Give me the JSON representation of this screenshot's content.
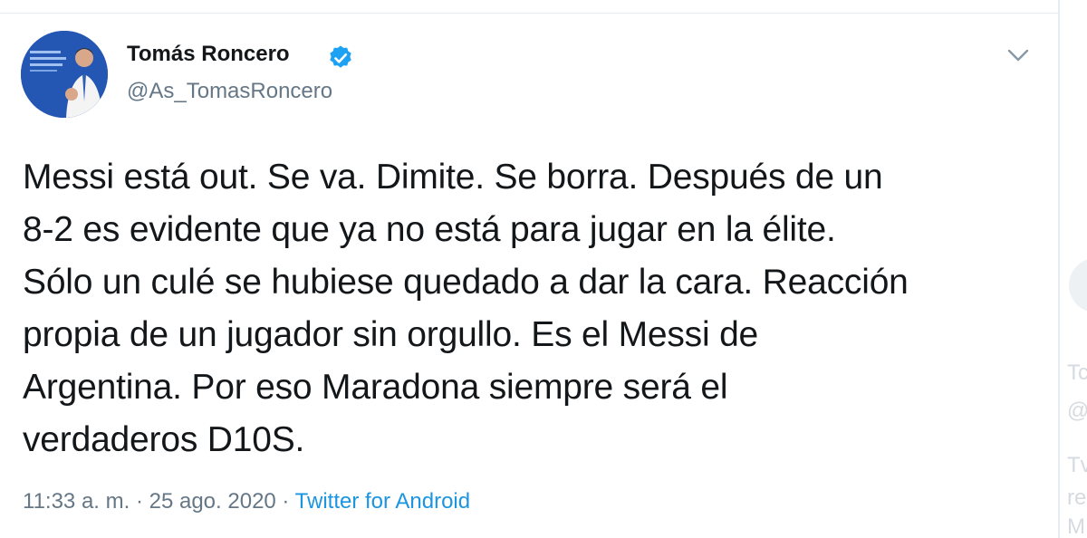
{
  "tweet": {
    "author": {
      "name": "Tomás Roncero",
      "handle": "@As_TomasRoncero",
      "verified": true
    },
    "text_lines": [
      "Messi está out. Se va. Dimite. Se borra. Después de un",
      "8-2 es evidente que ya no está para jugar en la élite.",
      "Sólo un culé se hubiese quedado a dar la cara. Reacción",
      "propia de un jugador sin orgullo. Es el Messi de",
      "Argentina. Por eso Maradona siempre será el",
      "verdaderos D10S."
    ],
    "time": "11:33 a. m.",
    "separator": " · ",
    "date": "25 ago. 2020",
    "source": "Twitter for Android",
    "icons": {
      "verified": "verified-badge-icon",
      "more": "chevron-down-icon"
    }
  },
  "sidebar": {
    "fragments": [
      "Tc",
      "@",
      "Tv",
      "re",
      "M"
    ]
  },
  "colors": {
    "text": "#14171a",
    "secondary": "#657786",
    "link": "#1b95e0",
    "verified": "#1da1f2",
    "divider": "#e6ecf0"
  }
}
